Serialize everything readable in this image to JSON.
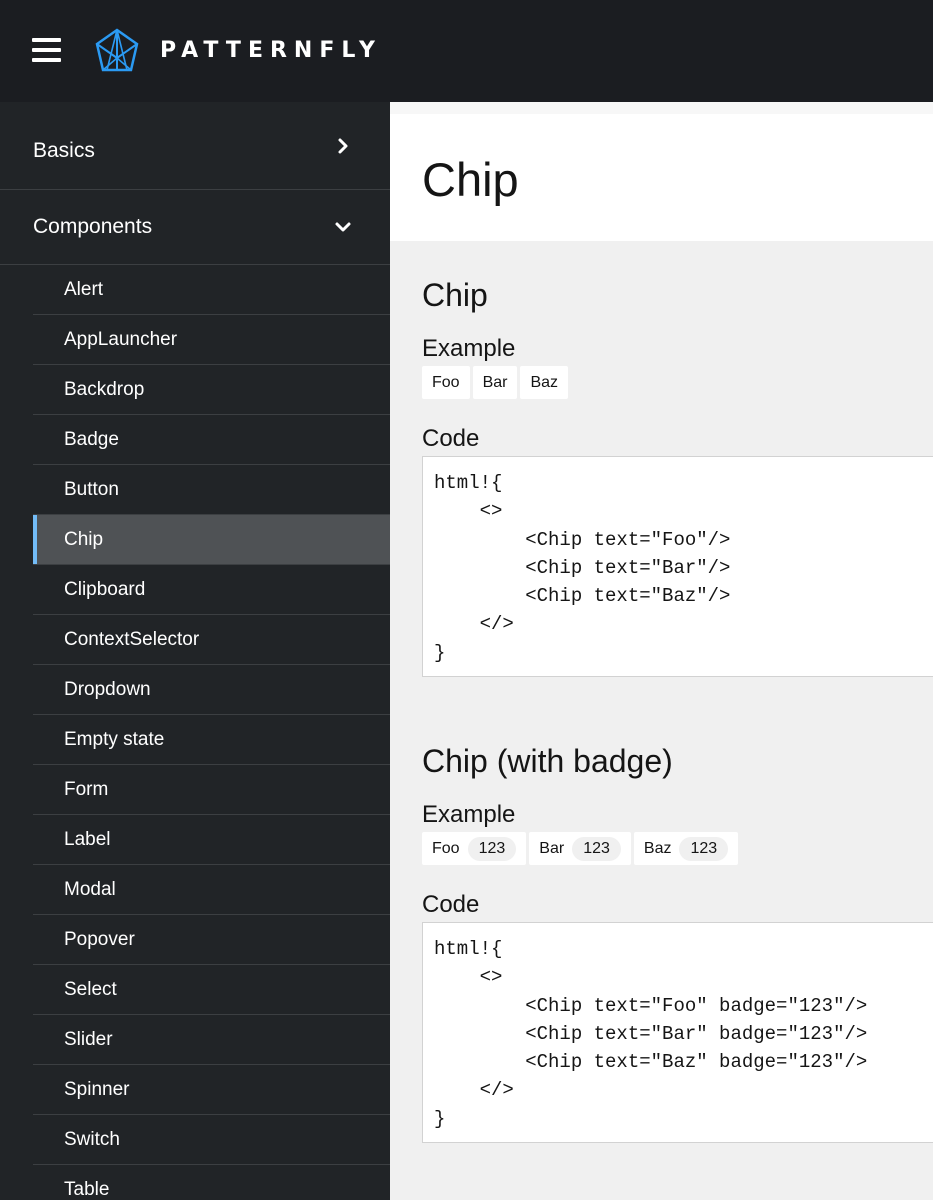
{
  "header": {
    "brand": "PATTERNFLY",
    "colors": {
      "background": "#1b1d21",
      "logo_accent": "#2b9af3"
    },
    "icons": {
      "menu": "hamburger-menu-icon",
      "logo": "patternfly-logo-icon"
    }
  },
  "sidebar": {
    "colors": {
      "background": "#212427",
      "active_background": "#4f5255",
      "active_accent": "#73bcf7"
    },
    "sections": [
      {
        "label": "Basics",
        "icon": "chevron-right-icon",
        "expanded": false
      },
      {
        "label": "Components",
        "icon": "chevron-down-icon",
        "expanded": true
      }
    ],
    "items": [
      {
        "label": "Alert"
      },
      {
        "label": "AppLauncher"
      },
      {
        "label": "Backdrop"
      },
      {
        "label": "Badge"
      },
      {
        "label": "Button"
      },
      {
        "label": "Chip",
        "active": true
      },
      {
        "label": "Clipboard"
      },
      {
        "label": "ContextSelector"
      },
      {
        "label": "Dropdown"
      },
      {
        "label": "Empty state"
      },
      {
        "label": "Form"
      },
      {
        "label": "Label"
      },
      {
        "label": "Modal"
      },
      {
        "label": "Popover"
      },
      {
        "label": "Select"
      },
      {
        "label": "Slider"
      },
      {
        "label": "Spinner"
      },
      {
        "label": "Switch"
      },
      {
        "label": "Table"
      }
    ]
  },
  "main": {
    "title": "Chip",
    "sections": [
      {
        "title": "Chip",
        "example_label": "Example",
        "chips": [
          {
            "text": "Foo"
          },
          {
            "text": "Bar"
          },
          {
            "text": "Baz"
          }
        ],
        "code_label": "Code",
        "code": "html!{\n    <>\n        <Chip text=\"Foo\"/>\n        <Chip text=\"Bar\"/>\n        <Chip text=\"Baz\"/>\n    </>\n}"
      },
      {
        "title": "Chip (with badge)",
        "example_label": "Example",
        "chips": [
          {
            "text": "Foo",
            "badge": "123"
          },
          {
            "text": "Bar",
            "badge": "123"
          },
          {
            "text": "Baz",
            "badge": "123"
          }
        ],
        "code_label": "Code",
        "code": "html!{\n    <>\n        <Chip text=\"Foo\" badge=\"123\"/>\n        <Chip text=\"Bar\" badge=\"123\"/>\n        <Chip text=\"Baz\" badge=\"123\"/>\n    </>\n}"
      }
    ]
  }
}
